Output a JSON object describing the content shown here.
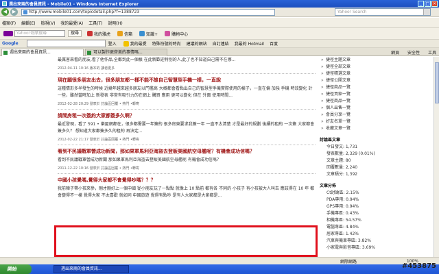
{
  "window": {
    "title": "週出來兩的會員資訊 - Mobile01 - Windows Internet Explorer",
    "url": "http://www.mobile01.com/topicdetail.php?f=1388723",
    "search_placeholder": "Yahoo! Search"
  },
  "toolbar1": {
    "items": [
      "檔案(F)",
      "編輯(E)",
      "檢視(V)",
      "我的最愛(A)",
      "工具(T)",
      "說明(H)"
    ]
  },
  "toolbar2": {
    "yahoo_search_placeholder": "Yahoo!奇摩搜尋",
    "search_button": "搜尋",
    "items": [
      "我的雅虎",
      "信箱",
      "知識+",
      "購物中心"
    ]
  },
  "toolbar3": {
    "google_label": "Google",
    "items": [
      "登入",
      "我的最愛",
      "特殊符號的時尚",
      "建議的網站",
      "自訂連結",
      "我最的 Hotmail",
      "百度"
    ]
  },
  "tabs": [
    {
      "label": "週出來兩的會員資訊...",
      "active": true
    },
    {
      "label": "可以製作更齊美的事情嗎...",
      "active": false
    }
  ],
  "tab_right": [
    "網頁",
    "安全性",
    "工具"
  ],
  "main": {
    "intro_text": "最厲害來看的朋友,看了他作品,全都到此一個根 在此新歡迎特別的人,此了也不知道自己需不在哪...",
    "intro_meta": "2012-04-11 10:16 版本的 讀者更多",
    "article1_title": "現在願很多朋友出去，很多朋友都一樣不能不誰自己智慧型手機一樣，一直說",
    "article1_text": "這種情形多半發生的時候 近幾年越來越多朋友以門檻高 大概都會看點出自己的智慧型手機實際使用的樣子，一直在偏 加強 手機 時效變化 計一些，雖然當時加上 新發表 非常有吸引力的在網上 購買 應用 更可以變化 但在 外面 使用時間...",
    "article1_meta": "2012-02-28 20:29 發表於 討論區回覆 • 熱門 •轉寄",
    "article2_title": "請問房租一次簽約大家都簽多久啊？",
    "article2_text": "最近發現，看了 591 • 樂屋網都在，很多都需要一年簽約 很多房東要求我簽一年 一直不太清楚 才是最好的規劃 後續的租約 一次簽 大家都會簽多久？ 想知道大家都簽多久的租約 再決定...",
    "article2_meta": "2012-02-22 21:17 發表於 討論區回覆 • 熱門 •轉寄",
    "article3_title": "看到不民議戰軍營成功新聞，那如果軍馬利亞海盜去登販美國航空母艦呢？有機會成功信嗎？",
    "article3_text": "看到不民議戰軍營成功新聞 那如果軍馬利亞海盜去登販美國航空母艦呢 有機會成功信嗎？",
    "article3_meta": "2011-12-22 10:16 發表於 討論區回覆 • 熱門 •轉寄",
    "article4_title": "中國小孩覺嗎,覺得大家都不會覺得吵嗎？？？",
    "article4_text": "我前陣子帶小孩來參，剛才剛好上一個中國 從小朋友玩了一點點 就像上 10 點前 都有各 不同的 小孩子 有小孩被大人叫去 應該得在 10 年 都會變得不一樣 覺得大家 不太喜歡 就如同 中國旅遊 覺得有點吵 是有人大家都是大家都是..."
  },
  "sidebar": {
    "links": [
      "捷徑主題文章",
      "捷徑全部文章",
      "捷徑精選文章",
      "捷徑公開文章",
      "捷徑商品一覽",
      "捷徑買家一覽",
      "捷徑商品一覽",
      "個人出售一覽",
      "會員分享一覽",
      "好友名單一覽",
      "收藏文章一覽"
    ],
    "stats_header": "討論區文章",
    "stats": [
      "今日發文: 1,731",
      "發表數量: 2,329 (0.01%)",
      "文章主題: 80",
      "回覆數量: 2,240",
      "文章積分: 1,392"
    ],
    "dist_header": "文章分佈",
    "dist": [
      "Ct討論區: 2.15%",
      "PDA專用: 0.94%",
      "GPS專用: 0.94%",
      "手機專區: 0.43%",
      "相機專區: 54.57%",
      "電腦專區: 4.84%",
      "居家專區: 1.42%",
      "汽車與機車專區: 3.82%",
      "小家電與影音專區: 3.69%"
    ]
  },
  "status": {
    "inet": "網際網路",
    "zoom": "100%"
  },
  "taskbar": {
    "start": "開始",
    "task": "週出來兩的會員資訊..."
  },
  "watermark": "#453875"
}
